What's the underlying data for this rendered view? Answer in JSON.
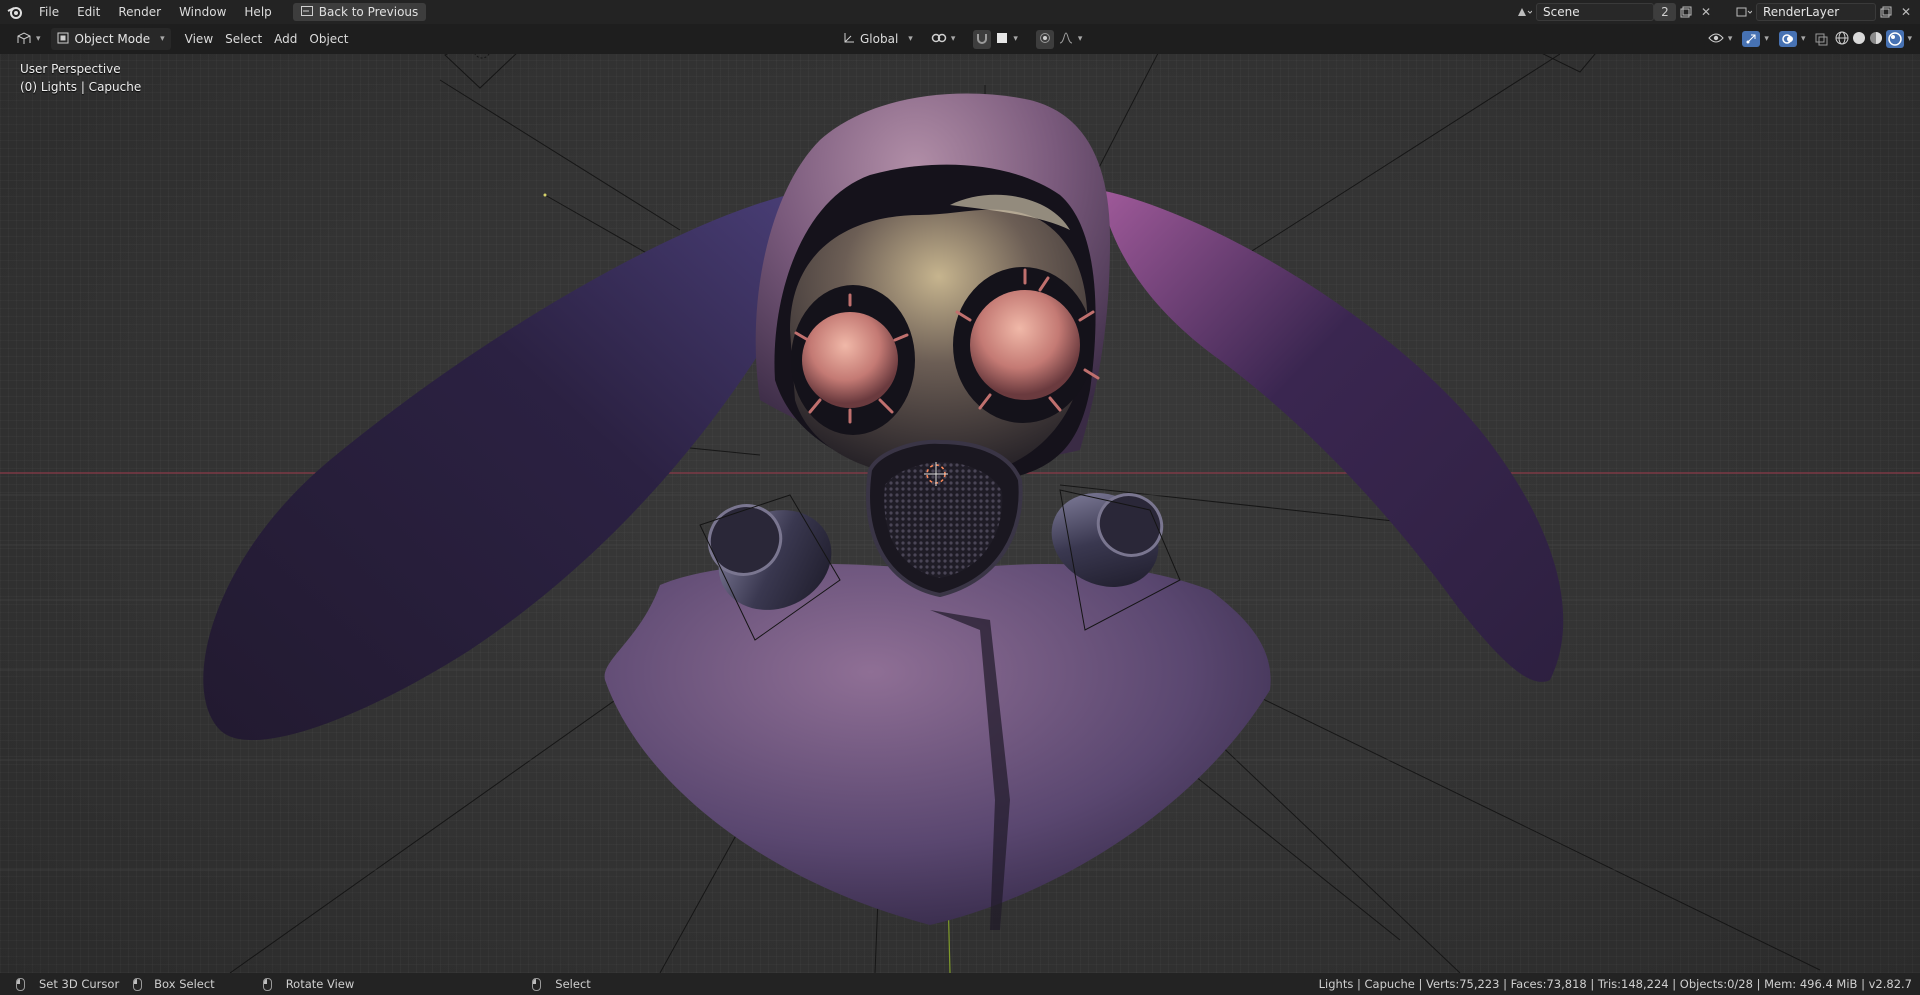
{
  "menu": {
    "items": [
      "File",
      "Edit",
      "Render",
      "Window",
      "Help"
    ],
    "back_button": "Back to Previous"
  },
  "topright": {
    "scene": "Scene",
    "scene_count": "2",
    "render_layer": "RenderLayer"
  },
  "header": {
    "mode": "Object Mode",
    "menus": [
      "View",
      "Select",
      "Add",
      "Object"
    ],
    "orientation": "Global"
  },
  "viewport": {
    "perspective": "User Perspective",
    "collection": "(0) Lights | Capuche"
  },
  "status": {
    "set_cursor": "Set 3D Cursor",
    "box_select": "Box Select",
    "rotate_view": "Rotate View",
    "select": "Select",
    "stats": "Lights | Capuche | Verts:75,223 | Faces:73,818 | Tris:148,224 | Objects:0/28 | Mem: 496.4 MiB | v2.82.7"
  },
  "colors": {
    "accent": "#4772b3",
    "x_axis": "#8a3a48",
    "y_axis": "#7f9b2a"
  }
}
